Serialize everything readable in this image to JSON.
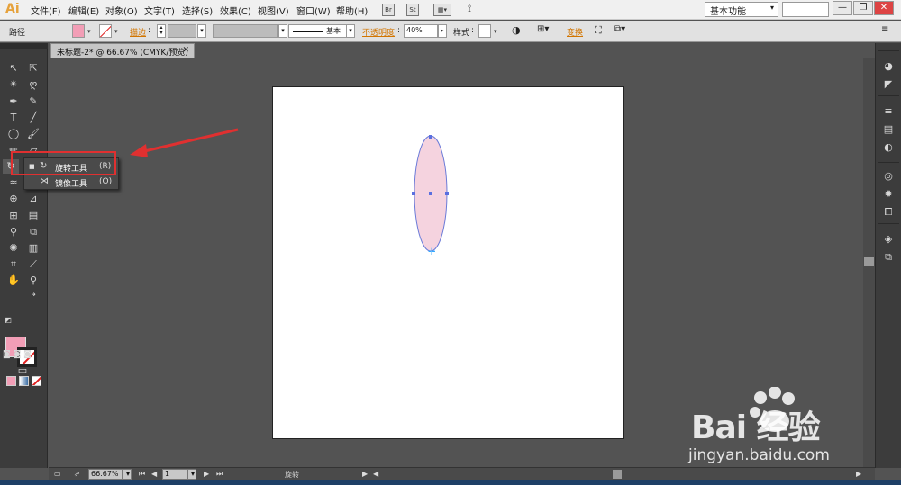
{
  "app": {
    "logo": "Ai",
    "logo_color": "#e6a23c"
  },
  "menu": {
    "items": [
      "文件(F)",
      "编辑(E)",
      "对象(O)",
      "文字(T)",
      "选择(S)",
      "效果(C)",
      "视图(V)",
      "窗口(W)",
      "帮助(H)"
    ],
    "br_icon": "Br",
    "st_icon": "St",
    "workspace": "基本功能",
    "window_controls": [
      "—",
      "❐",
      "✕"
    ]
  },
  "control_bar": {
    "object_type": "路径",
    "stroke_label": "描边",
    "stroke_style": "基本",
    "opacity_label": "不透明度",
    "opacity_value": "40%",
    "style_label": "样式",
    "transform_label": "变换",
    "fill_color": "#f29eb6"
  },
  "document": {
    "tab_title": "未标题-2* @ 66.67% (CMYK/预览)",
    "close": "✕"
  },
  "toolbox": {
    "fill_color": "#f29eb6",
    "flyout": {
      "items": [
        {
          "label": "旋转工具",
          "shortcut": "(R)",
          "icon": "rotate-icon"
        },
        {
          "label": "镜像工具",
          "shortcut": "(O)",
          "icon": "reflect-icon"
        }
      ]
    }
  },
  "canvas": {
    "ellipse_fill": "#f5d3df",
    "ellipse_stroke": "#6b7bd8"
  },
  "status": {
    "zoom": "66.67%",
    "page": "1",
    "current_tool": "旋转"
  },
  "watermark": {
    "main": "Bai  经验",
    "sub": "jingyan.baidu.com"
  },
  "annotation": {
    "color": "#e03030"
  }
}
